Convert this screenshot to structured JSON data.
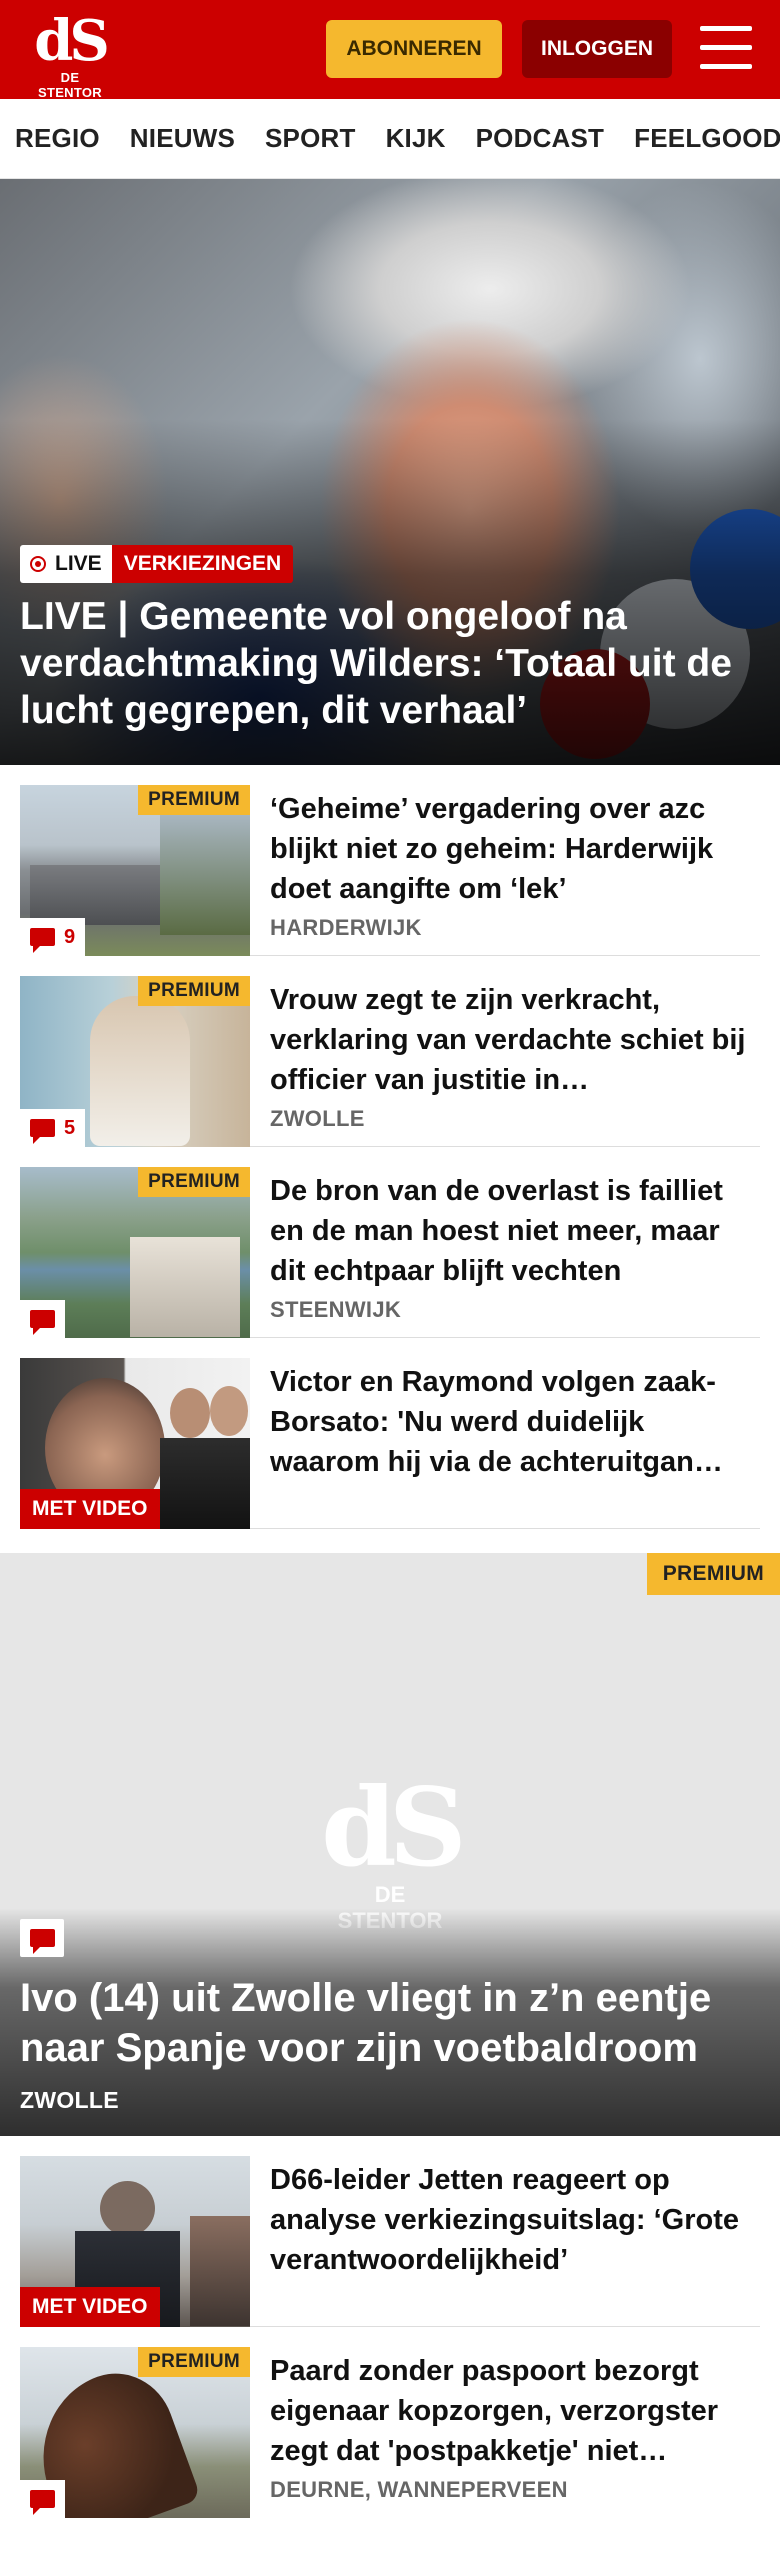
{
  "header": {
    "logo_mark": "dS",
    "logo_text": "DE STENTOR",
    "subscribe_label": "ABONNEREN",
    "login_label": "INLOGGEN",
    "menu_icon": "hamburger-menu-icon",
    "brand_color": "#cc0000",
    "subscribe_color": "#f5b82e"
  },
  "nav": {
    "items": [
      "REGIO",
      "NIEUWS",
      "SPORT",
      "KIJK",
      "PODCAST",
      "FEELGOOD"
    ]
  },
  "hero": {
    "live_label": "LIVE",
    "section_label": "VERKIEZINGEN",
    "title": "LIVE | Gemeente vol ongeloof na verdachtmaking Wilders: ‘Totaal uit de lucht gegrepen, dit verhaal’"
  },
  "articles": [
    {
      "title": "‘Geheime’ vergadering over azc blijkt niet zo geheim: Harderwijk doet aangifte om ‘lek’",
      "location": "HARDERWIJK",
      "premium": "PREMIUM",
      "comments": "9"
    },
    {
      "title": "Vrouw zegt te zijn verkracht, verklaring van verdachte schiet bij officier van justitie in…",
      "location": "ZWOLLE",
      "premium": "PREMIUM",
      "comments": "5"
    },
    {
      "title": "De bron van de overlast is failliet en de man hoest niet meer, maar dit echtpaar blijft vechten",
      "location": "STEENWIJK",
      "premium": "PREMIUM"
    },
    {
      "title": "Victor en Raymond volgen zaak-Borsato: 'Nu werd duidelijk waarom hij via de achteruitgan…",
      "video_label": "MET VIDEO"
    }
  ],
  "feature": {
    "premium": "PREMIUM",
    "logo_mark": "dS",
    "logo_text": "DE STENTOR",
    "title": "Ivo (14) uit Zwolle vliegt in z’n eentje naar Spanje voor zijn voetbaldroom",
    "location": "ZWOLLE"
  },
  "articles_bottom": [
    {
      "title": "D66-leider Jetten reageert op analyse verkiezingsuitslag: ‘Grote verantwoordelijkheid’",
      "video_label": "MET VIDEO"
    },
    {
      "title": "Paard zonder paspoort bezorgt eigenaar kopzorgen, verzorgster zegt dat 'postpakketje' niet…",
      "location": "DEURNE, WANNEPERVEEN",
      "premium": "PREMIUM"
    }
  ]
}
